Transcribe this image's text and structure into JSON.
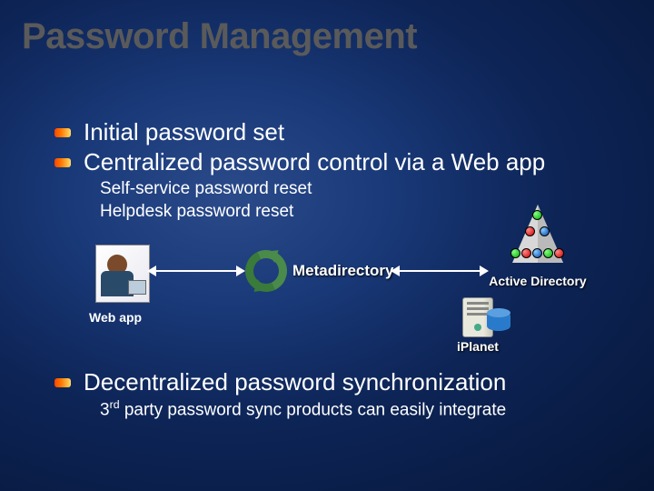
{
  "title": "Password Management",
  "bullets": [
    "Initial password set",
    "Centralized password control via a Web app",
    "Decentralized password synchronization"
  ],
  "sub1": "Self-service password reset",
  "sub2": "Helpdesk password reset",
  "labels": {
    "webapp": "Web app",
    "metadirectory": "Metadirectory",
    "ad": "Active Directory",
    "iplanet": "iPlanet"
  },
  "third_pre": "3",
  "third_sup": "rd",
  "third_post": " party password sync products can easily integrate"
}
